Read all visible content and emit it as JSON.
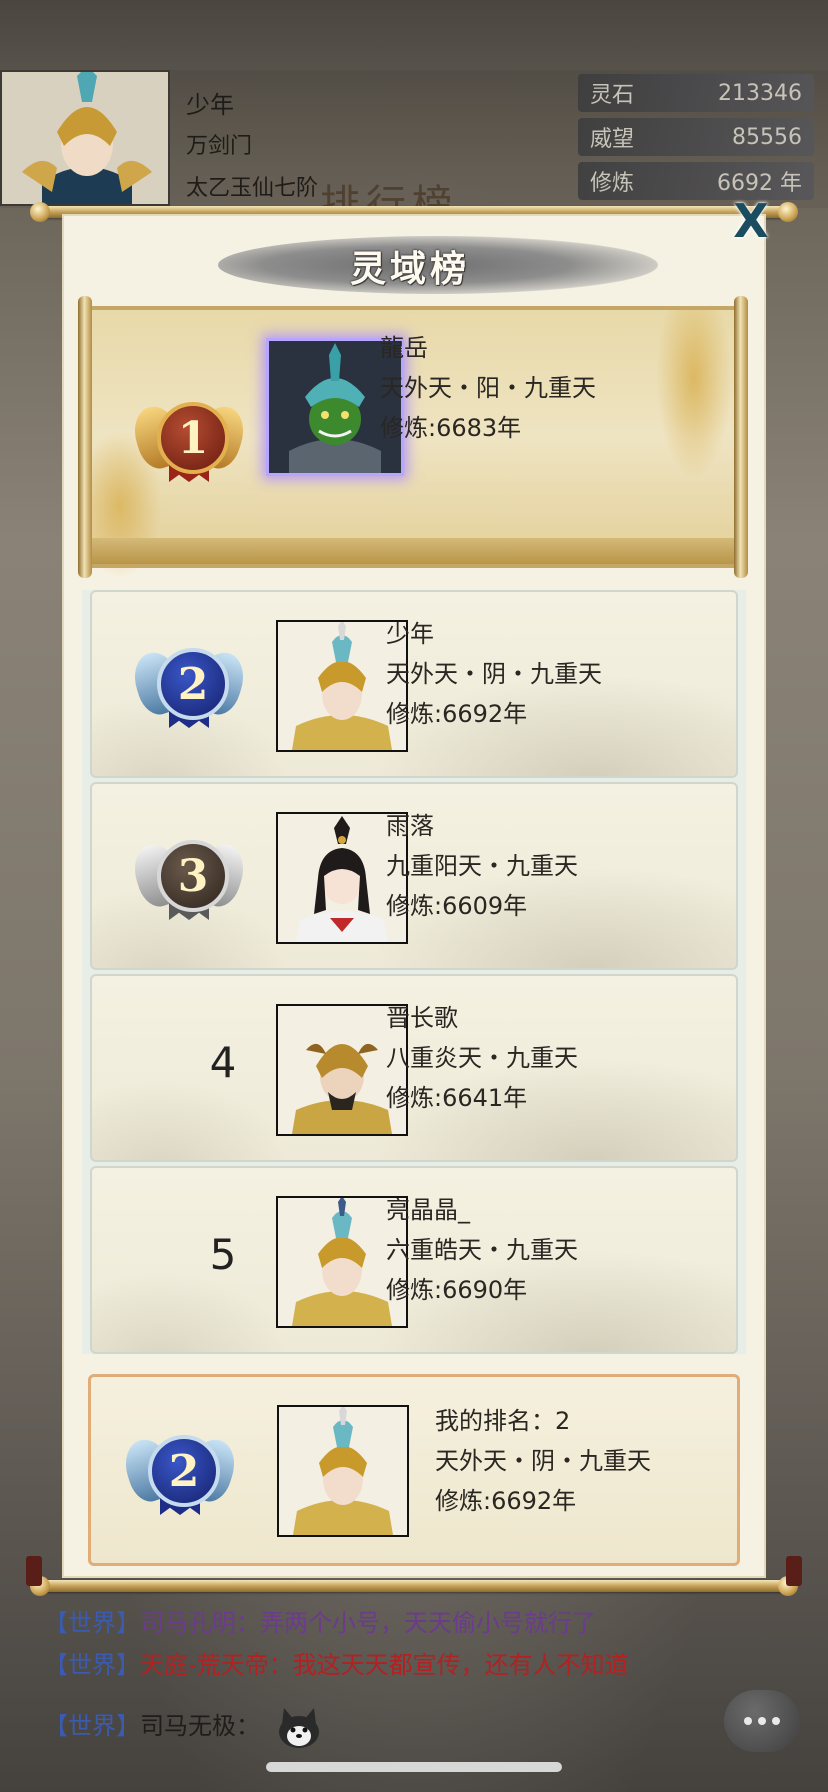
{
  "player": {
    "name": "少年",
    "sect": "万剑门",
    "realm": "太乙玉仙七阶"
  },
  "stats": [
    {
      "label": "灵石",
      "value": "213346"
    },
    {
      "label": "威望",
      "value": "85556"
    },
    {
      "label": "修炼",
      "value": "6692 年"
    }
  ],
  "background_title": "排行榜",
  "modal": {
    "title": "灵域榜",
    "close_label": "X"
  },
  "rankings": [
    {
      "rank": "1",
      "name": "龍岳",
      "realm": "天外天・阳・九重天",
      "cultivation": "修炼:6683年"
    },
    {
      "rank": "2",
      "name": "少年",
      "realm": "天外天・阴・九重天",
      "cultivation": "修炼:6692年"
    },
    {
      "rank": "3",
      "name": "雨落",
      "realm": "九重阳天・九重天",
      "cultivation": "修炼:6609年"
    },
    {
      "rank": "4",
      "name": "晋长歌",
      "realm": "八重炎天・九重天",
      "cultivation": "修炼:6641年"
    },
    {
      "rank": "5",
      "name": "亮晶晶_",
      "realm": "六重皓天・九重天",
      "cultivation": "修炼:6690年"
    }
  ],
  "my_rank": {
    "rank": "2",
    "label": "我的排名：2",
    "realm": "天外天・阴・九重天",
    "cultivation": "修炼:6692年"
  },
  "chat": [
    {
      "channel": "【世界】",
      "nick": "司马孔明",
      "message": "：弄两个小号，天天偷小号就行了"
    },
    {
      "channel": "【世界】",
      "nick": "天庭-荒天帝",
      "message": "：我这天天都宣传，还有人不知道"
    },
    {
      "channel": "【世界】",
      "nick": "司马无极",
      "message": "：",
      "emoji": "dog-emoji"
    }
  ],
  "colors": {
    "chat_channel": "#3b5bb0",
    "chat_purple": "#6c3a8e",
    "chat_red": "#b52020",
    "close_button": "#1b4d61",
    "gold_accent": "#c6a158"
  }
}
